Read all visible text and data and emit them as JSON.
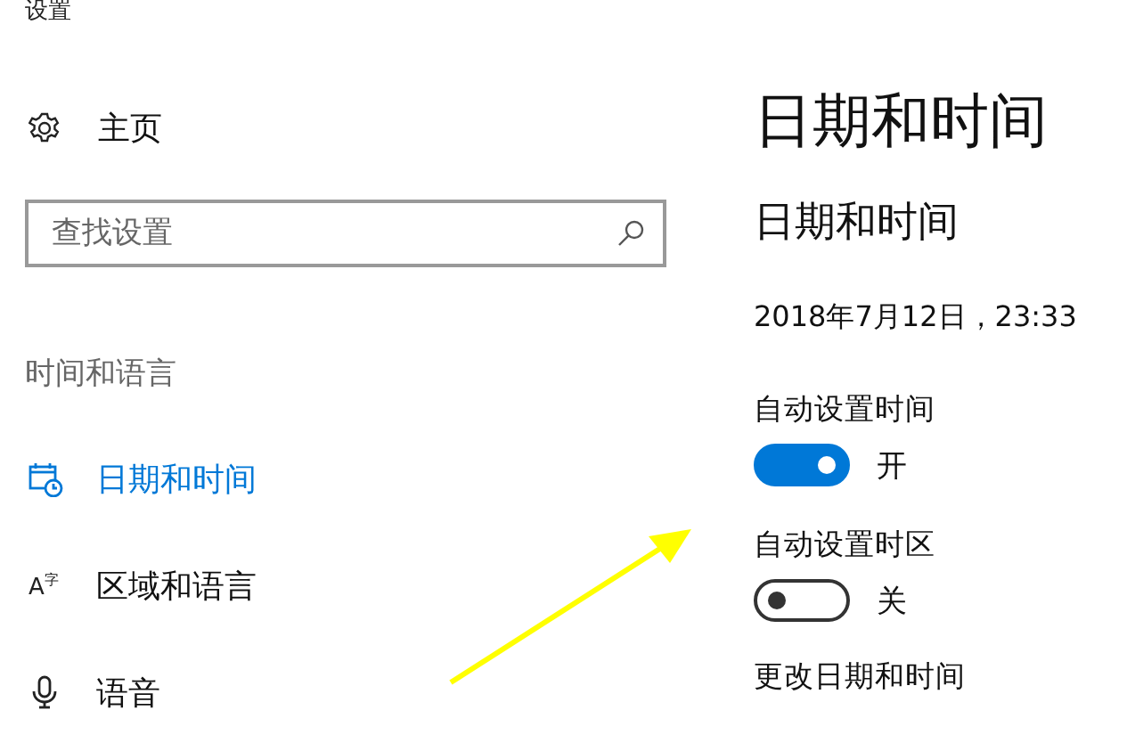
{
  "window": {
    "title": "设置"
  },
  "sidebar": {
    "home": {
      "label": "主页"
    },
    "search": {
      "placeholder": "查找设置"
    },
    "section": "时间和语言",
    "items": [
      {
        "label": "日期和时间",
        "kind": "calendar",
        "selected": true
      },
      {
        "label": "区域和语言",
        "kind": "language",
        "glyph": "A$^{字}$",
        "selected": false
      },
      {
        "label": "语音",
        "kind": "microphone",
        "selected": false
      }
    ]
  },
  "content": {
    "title": "日期和时间",
    "subtitle": "日期和时间",
    "current": "2018年7月12日，23:33",
    "settings": [
      {
        "label": "自动设置时间",
        "on": true,
        "state_text": "开"
      },
      {
        "label": "自动设置时区",
        "on": false,
        "state_text": "关"
      }
    ],
    "link": "更改日期和时间"
  },
  "annotation": {
    "kind": "arrow"
  }
}
